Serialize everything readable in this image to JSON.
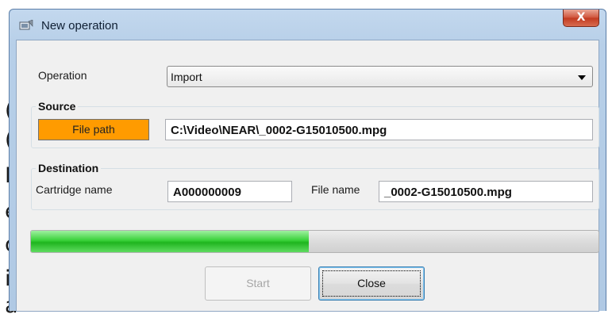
{
  "edge_text": [
    "(",
    "(",
    "M",
    "e",
    "d",
    "i",
    "a"
  ],
  "window": {
    "title": "New operation",
    "close_symbol": "X"
  },
  "operation": {
    "label": "Operation",
    "selected": "Import"
  },
  "source": {
    "group_title": "Source",
    "file_path_button": "File path",
    "file_path_value": "C:\\Video\\NEAR\\_0002-G15010500.mpg"
  },
  "destination": {
    "group_title": "Destination",
    "cartridge_label": "Cartridge name",
    "cartridge_value": "A000000009",
    "file_name_label": "File name",
    "file_name_value": "_0002-G15010500.mpg"
  },
  "progress": {
    "fraction": 0.49
  },
  "buttons": {
    "start": "Start",
    "close": "Close"
  },
  "colors": {
    "file_path_button": "#ff9b00",
    "progress_fill": "#1fb51f"
  }
}
